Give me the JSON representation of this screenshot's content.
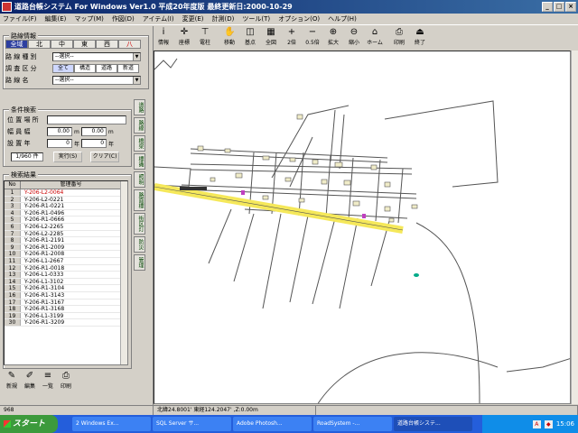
{
  "window": {
    "title": "道路台帳システム For Windows Ver1.0  平成20年度版  最終更新日:2000-10-29"
  },
  "menu": [
    "ファイル(F)",
    "編集(E)",
    "マップ(M)",
    "作図(D)",
    "アイテム(I)",
    "変更(E)",
    "計測(D)",
    "ツール(T)",
    "オプション(O)",
    "ヘルプ(H)"
  ],
  "toolbar": [
    {
      "icon": "info-icon",
      "glyph": "i",
      "label": "情報"
    },
    {
      "icon": "coordinates-icon",
      "glyph": "✛",
      "label": "座標"
    },
    {
      "icon": "electric-pole-icon",
      "glyph": "⊤",
      "label": "電柱"
    },
    {
      "icon": "move-icon",
      "glyph": "✋",
      "label": "移動"
    },
    {
      "icon": "reference-icon",
      "glyph": "◫",
      "label": "基点"
    },
    {
      "icon": "full-map-icon",
      "glyph": "▦",
      "label": "全図"
    },
    {
      "icon": "zoom-2x-icon",
      "glyph": "+",
      "label": "2倍"
    },
    {
      "icon": "zoom-half-icon",
      "glyph": "−",
      "label": "0.5倍"
    },
    {
      "icon": "zoom-in-icon",
      "glyph": "⊕",
      "label": "拡大"
    },
    {
      "icon": "zoom-out-icon",
      "glyph": "⊖",
      "label": "縮小"
    },
    {
      "icon": "home-icon",
      "glyph": "⌂",
      "label": "ホーム"
    },
    {
      "icon": "print-icon",
      "glyph": "⎙",
      "label": "印刷"
    },
    {
      "icon": "exit-icon",
      "glyph": "⏏",
      "label": "終了"
    }
  ],
  "left": {
    "route_group_title": "路線情報",
    "directions": [
      "全域",
      "北",
      "中",
      "東",
      "西",
      "八"
    ],
    "route_type_label": "路 線 種 別",
    "route_type_value": "--選択--",
    "survey_label": "調 査 区 分",
    "survey_options": [
      "全て",
      "構造",
      "道路",
      "新道"
    ],
    "route_name_label": "路 線 名",
    "route_name_value": "--選択--",
    "cond_group_title": "条件検索",
    "location_label": "位 置 場 所",
    "road_width_label": "幅 員 幅",
    "road_width_from": "0.00",
    "road_width_to": "0.00",
    "road_width_unit": "m",
    "year_label": "設 置 年",
    "year_from": "0",
    "year_to": "0",
    "year_unit": "年",
    "count": "1/960 件",
    "run_button": "実行(S)",
    "clear_button": "クリア(C)",
    "results_group_title": "検索結果",
    "col_no": "No",
    "col_id": "管理番号",
    "rows": [
      "Y-206-L2-0064",
      "Y-206-L2-0221",
      "Y-206-R1-0221",
      "Y-206-R1-0496",
      "Y-206-R1-0666",
      "Y-206-L2-2265",
      "Y-206-L2-2285",
      "Y-206-R1-2191",
      "Y-206-R1-2009",
      "Y-206-R1-2008",
      "Y-206-L1-2667",
      "Y-206-R1-0018",
      "Y-206-L1-0333",
      "Y-206-L1-3102",
      "Y-206-R1-3104",
      "Y-206-R1-3143",
      "Y-206-R1-3167",
      "Y-206-R1-3168",
      "Y-206-L1-3199",
      "Y-206-R1-3209"
    ],
    "row_numbers": [
      "1",
      "2",
      "3",
      "4",
      "5",
      "6",
      "7",
      "8",
      "9",
      "10",
      "11",
      "12",
      "13",
      "14",
      "15",
      "16",
      "17",
      "18",
      "19",
      "30"
    ],
    "side_tabs": [
      "道路",
      "路線",
      "橋梁",
      "標識",
      "照明",
      "路面標",
      "街区灯",
      "防災",
      "管理"
    ],
    "bottom_buttons": [
      {
        "icon": "new-icon",
        "glyph": "✎",
        "label": "新規"
      },
      {
        "icon": "edit-icon",
        "glyph": "✐",
        "label": "編集"
      },
      {
        "icon": "list-icon",
        "glyph": "≡",
        "label": "一覧"
      },
      {
        "icon": "print-small-icon",
        "glyph": "⎙",
        "label": "印刷"
      }
    ]
  },
  "status": {
    "count": "968",
    "coords": "北緯24.8001'  東経124.2047'  ,Z:0.00m"
  },
  "taskbar": {
    "start": "スタート",
    "tasks": [
      "2 Windows Ex...",
      "SQL Server サ...",
      "Adobe Photosh...",
      "RoadSystem -...",
      "道路台帳システ..."
    ],
    "clock": "15:06"
  },
  "colors": {
    "highlight_road": "#f5e85a",
    "title_bar": "#0a246a",
    "selected_text": "#cc0000"
  }
}
